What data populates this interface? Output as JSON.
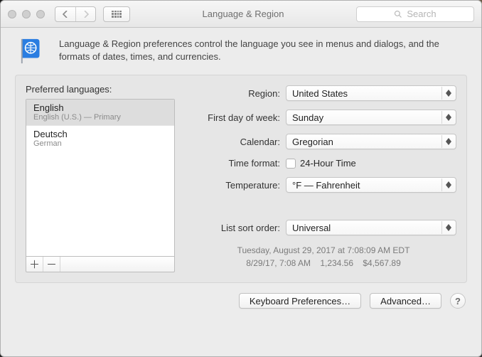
{
  "titlebar": {
    "title": "Language & Region",
    "search_placeholder": "Search"
  },
  "description": "Language & Region preferences control the language you see in menus and dialogs, and the formats of dates, times, and currencies.",
  "preferred_label": "Preferred languages:",
  "languages": [
    {
      "name": "English",
      "sub": "English (U.S.) — Primary"
    },
    {
      "name": "Deutsch",
      "sub": "German"
    }
  ],
  "form": {
    "region_label": "Region:",
    "region_value": "United States",
    "firstday_label": "First day of week:",
    "firstday_value": "Sunday",
    "calendar_label": "Calendar:",
    "calendar_value": "Gregorian",
    "timeformat_label": "Time format:",
    "timeformat_checkbox": "24-Hour Time",
    "temperature_label": "Temperature:",
    "temperature_value": "°F — Fahrenheit",
    "listsort_label": "List sort order:",
    "listsort_value": "Universal"
  },
  "example": {
    "line1": "Tuesday, August 29, 2017 at 7:08:09 AM EDT",
    "line2": "8/29/17, 7:08 AM    1,234.56    $4,567.89"
  },
  "buttons": {
    "keyboard": "Keyboard Preferences…",
    "advanced": "Advanced…"
  }
}
